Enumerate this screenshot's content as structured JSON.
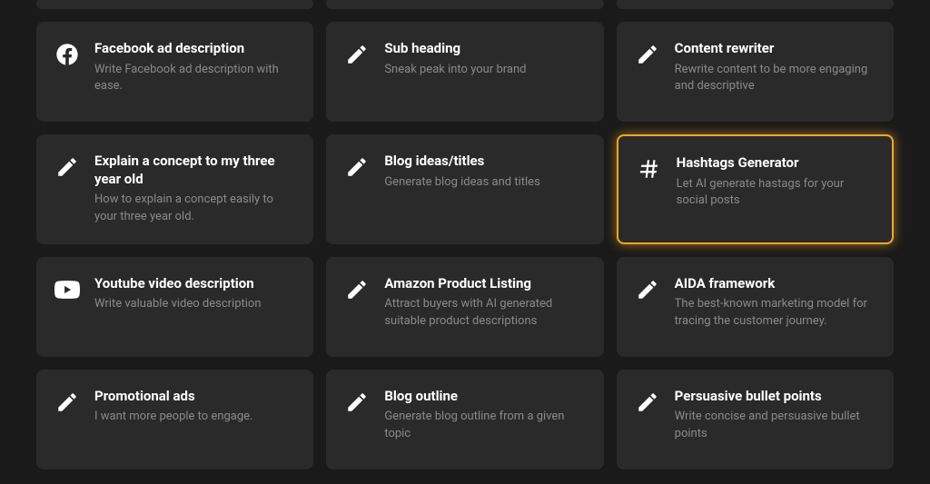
{
  "cards": [
    {
      "icon": "facebook",
      "title": "Facebook ad description",
      "desc": "Write Facebook ad description with ease.",
      "highlight": false
    },
    {
      "icon": "pencil",
      "title": "Sub heading",
      "desc": "Sneak peak into your brand",
      "highlight": false
    },
    {
      "icon": "pencil",
      "title": "Content rewriter",
      "desc": "Rewrite content to be more engaging and descriptive",
      "highlight": false
    },
    {
      "icon": "pencil",
      "title": "Explain a concept to my three year old",
      "desc": "How to explain a concept easily to your three year old.",
      "highlight": false
    },
    {
      "icon": "pencil",
      "title": "Blog ideas/titles",
      "desc": "Generate blog ideas and titles",
      "highlight": false
    },
    {
      "icon": "hashtag",
      "title": "Hashtags Generator",
      "desc": "Let AI generate hastags for your social posts",
      "highlight": true
    },
    {
      "icon": "youtube",
      "title": "Youtube video description",
      "desc": "Write valuable video description",
      "highlight": false
    },
    {
      "icon": "pencil",
      "title": "Amazon Product Listing",
      "desc": "Attract buyers with AI generated suitable product descriptions",
      "highlight": false
    },
    {
      "icon": "pencil",
      "title": "AIDA framework",
      "desc": "The best-known marketing model for tracing the customer journey.",
      "highlight": false
    },
    {
      "icon": "pencil",
      "title": "Promotional ads",
      "desc": "I want more people to engage.",
      "highlight": false
    },
    {
      "icon": "pencil",
      "title": "Blog outline",
      "desc": "Generate blog outline from a given topic",
      "highlight": false
    },
    {
      "icon": "pencil",
      "title": "Persuasive bullet points",
      "desc": "Write concise and persuasive bullet points",
      "highlight": false
    }
  ]
}
